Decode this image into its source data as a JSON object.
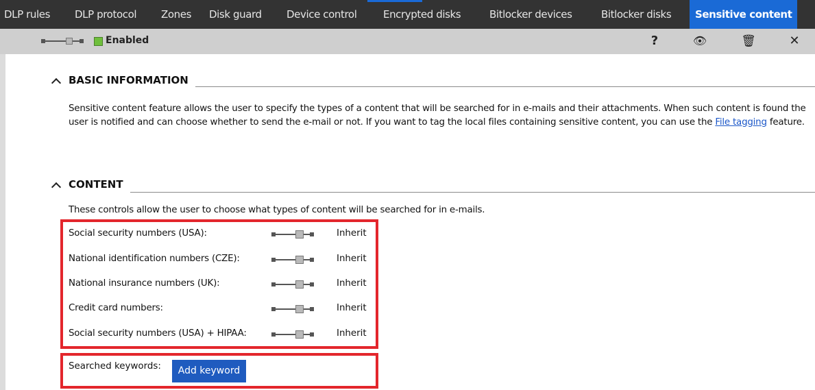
{
  "tabs": [
    {
      "label": "DLP rules"
    },
    {
      "label": "DLP protocol"
    },
    {
      "label": "Zones"
    },
    {
      "label": "Disk guard"
    },
    {
      "label": "Device control"
    },
    {
      "label": "Encrypted disks"
    },
    {
      "label": "Bitlocker devices"
    },
    {
      "label": "Bitlocker disks"
    },
    {
      "label": "Sensitive content",
      "active": true
    }
  ],
  "toolbar": {
    "status_label": "Enabled",
    "status_color": "#6fbf3c",
    "help_icon": "question-mark-icon",
    "help_glyph": "?",
    "preview_icon": "eye-icon",
    "preview_glyph": "👁",
    "delete_icon": "trash-icon",
    "delete_glyph": "🗑",
    "close_icon": "close-icon",
    "close_glyph": "✕"
  },
  "basic_information": {
    "title": "BASIC INFORMATION",
    "text_before_link": "Sensitive content feature allows the user to specify the types of a content that will be searched for in e-mails and their attachments. When such content is found the user is notified and can choose whether to send the e-mail or not. If you want to tag the local files containing sensitive content, you can use the ",
    "link_text": "File tagging",
    "text_after_link": " feature."
  },
  "content": {
    "title": "CONTENT",
    "intro": "These controls allow the user to choose what types of content will be searched for in e-mails.",
    "options": [
      {
        "label": "Social security numbers (USA):",
        "value": "Inherit"
      },
      {
        "label": "National identification numbers (CZE):",
        "value": "Inherit"
      },
      {
        "label": "National insurance numbers (UK):",
        "value": "Inherit"
      },
      {
        "label": "Credit card numbers:",
        "value": "Inherit"
      },
      {
        "label": "Social security numbers (USA) + HIPAA:",
        "value": "Inherit"
      }
    ],
    "keywords_label": "Searched keywords:",
    "add_keyword_label": "Add keyword"
  },
  "colors": {
    "accent": "#1a6ad6",
    "highlight": "#e3262c",
    "button": "#1f5bbf"
  }
}
